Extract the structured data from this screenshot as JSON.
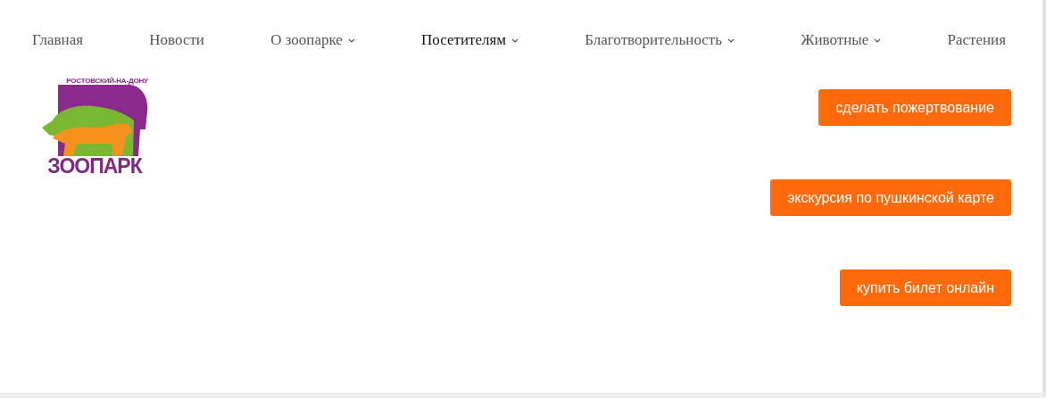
{
  "nav": [
    {
      "label": "Главная",
      "selected": false,
      "dropdown": false
    },
    {
      "label": "Новости",
      "selected": false,
      "dropdown": false
    },
    {
      "label": "О зоопарке",
      "selected": false,
      "dropdown": true
    },
    {
      "label": "Посетителям",
      "selected": true,
      "dropdown": true
    },
    {
      "label": "Благотворительность",
      "selected": false,
      "dropdown": true
    },
    {
      "label": "Животные",
      "selected": false,
      "dropdown": true
    },
    {
      "label": "Растения",
      "selected": false,
      "dropdown": false
    }
  ],
  "logo": {
    "city": "РОСТОВСКИЙ-НА-ДОНУ",
    "name": "ЗООПАРК"
  },
  "buttons": [
    "сделать пожертвование",
    "экскурсия по пушкинской карте",
    "купить билет онлайн"
  ]
}
